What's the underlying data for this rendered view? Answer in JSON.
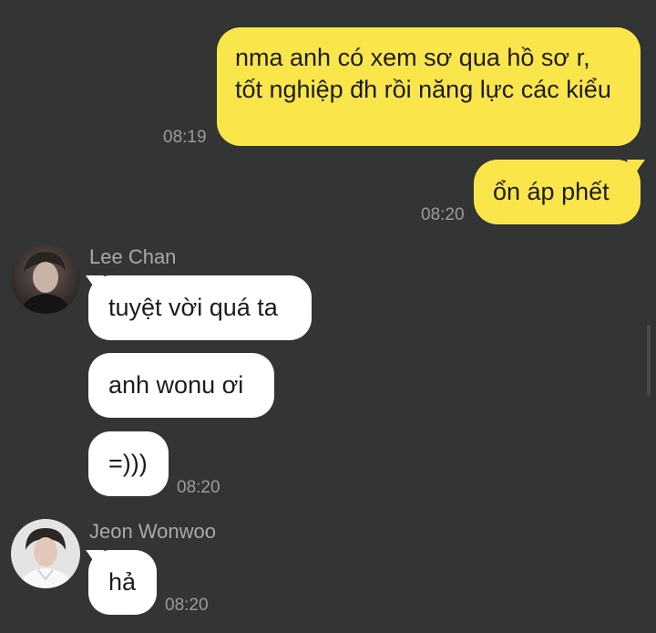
{
  "colors": {
    "background": "#333434",
    "outgoing_bubble": "#fae64b",
    "incoming_bubble": "#ffffff",
    "timestamp": "#9b9c9c",
    "sender_name": "#a8a9a9"
  },
  "messages": {
    "m1": {
      "text": "nma anh có xem sơ qua hồ sơ r, tốt nghiệp đh rồi năng lực các kiểu",
      "time": "08:19"
    },
    "m2": {
      "text": "ổn áp phết",
      "time": "08:20"
    },
    "group1": {
      "sender": "Lee Chan",
      "m1": "tuyệt vời quá ta",
      "m2": "anh wonu ơi",
      "m3": "=)))",
      "time": "08:20"
    },
    "group2": {
      "sender": "Jeon Wonwoo",
      "m1": "hả",
      "time": "08:20"
    }
  }
}
